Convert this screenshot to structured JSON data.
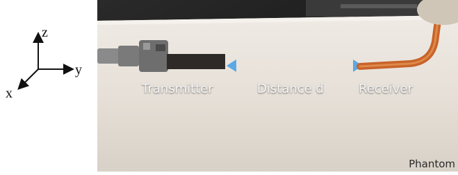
{
  "axes": {
    "z_label": "z",
    "y_label": "y",
    "x_label": "x"
  },
  "photo": {
    "labels": {
      "transmitter": "Transmitter",
      "distance": "Distance d",
      "receiver": "Receiver",
      "phantom": "Phantom"
    },
    "colors": {
      "background_dark": "#1a1a1a",
      "phantom_block": "#e8e3dc",
      "arrow": "#5aa9e6",
      "receiver_lead": "#c8642a",
      "transmitter_metal": "#6e6e6e"
    }
  }
}
